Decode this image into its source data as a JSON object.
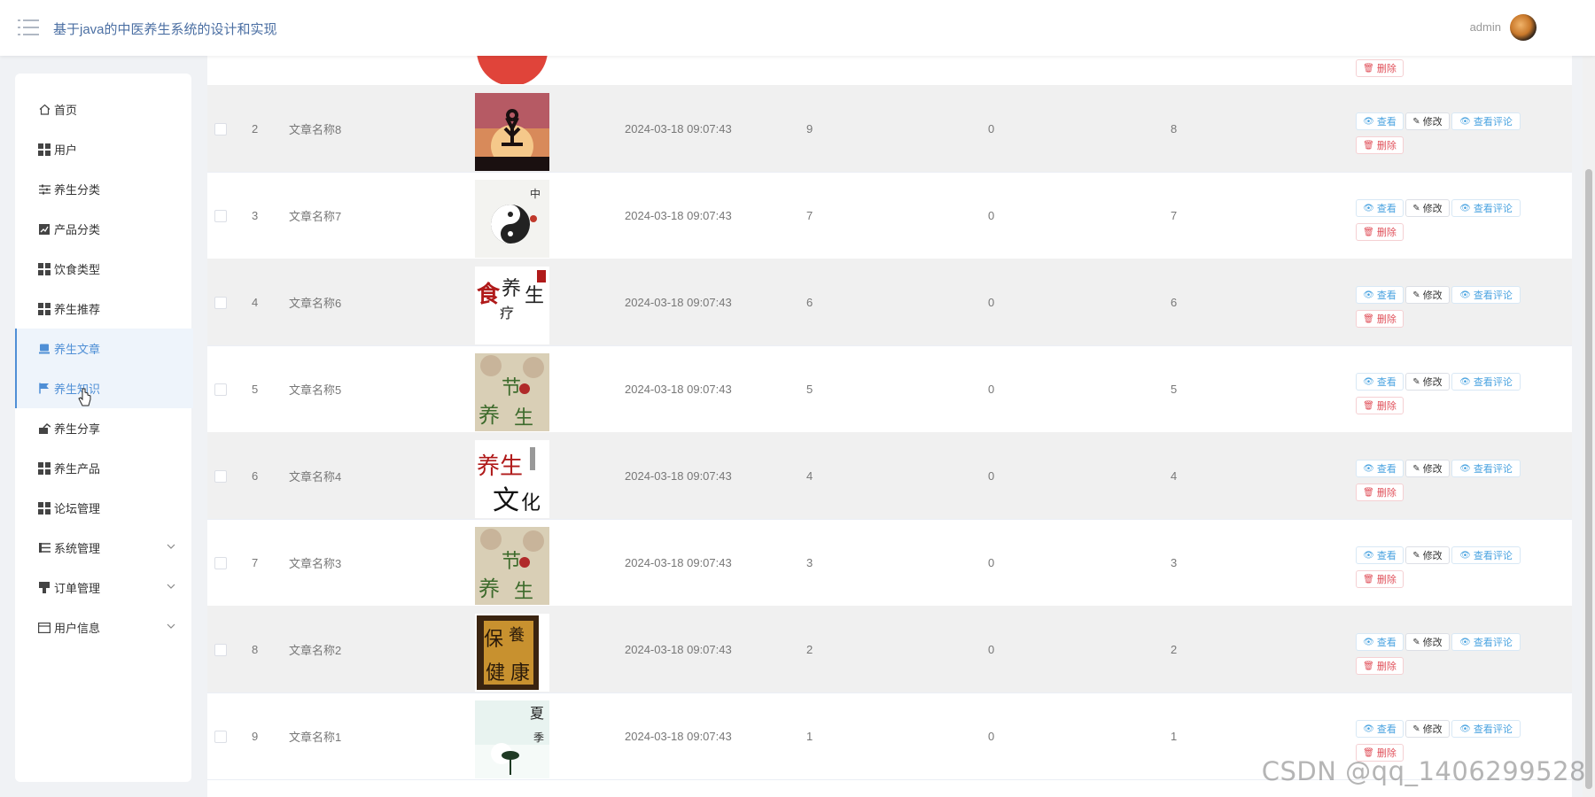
{
  "header": {
    "title": "基于java的中医养生系统的设计和实现",
    "user": "admin"
  },
  "sidebar": {
    "items": [
      {
        "label": "首页",
        "icon": "home-icon"
      },
      {
        "label": "用户",
        "icon": "grid-icon"
      },
      {
        "label": "养生分类",
        "icon": "sliders-icon"
      },
      {
        "label": "产品分类",
        "icon": "chart-icon"
      },
      {
        "label": "饮食类型",
        "icon": "grid-icon"
      },
      {
        "label": "养生推荐",
        "icon": "grid-icon"
      },
      {
        "label": "养生文章",
        "icon": "article-icon",
        "active": true
      },
      {
        "label": "养生知识",
        "icon": "flag-icon",
        "active": true
      },
      {
        "label": "养生分享",
        "icon": "share-icon"
      },
      {
        "label": "养生产品",
        "icon": "grid-icon"
      },
      {
        "label": "论坛管理",
        "icon": "grid-icon"
      },
      {
        "label": "系统管理",
        "icon": "list-icon",
        "expandable": true
      },
      {
        "label": "订单管理",
        "icon": "stamp-icon",
        "expandable": true
      },
      {
        "label": "用户信息",
        "icon": "card-icon",
        "expandable": true
      }
    ]
  },
  "actions": {
    "view": "查看",
    "edit": "修改",
    "comments": "查看评论",
    "delete": "删除"
  },
  "rows": [
    {
      "index": "2",
      "name": "文章名称8",
      "time": "2024-03-18 09:07:43",
      "c1": "9",
      "c2": "0",
      "c3": "8",
      "thumb": "yoga"
    },
    {
      "index": "3",
      "name": "文章名称7",
      "time": "2024-03-18 09:07:43",
      "c1": "7",
      "c2": "0",
      "c3": "7",
      "thumb": "taiji"
    },
    {
      "index": "4",
      "name": "文章名称6",
      "time": "2024-03-18 09:07:43",
      "c1": "6",
      "c2": "0",
      "c3": "6",
      "thumb": "shiliao"
    },
    {
      "index": "5",
      "name": "文章名称5",
      "time": "2024-03-18 09:07:43",
      "c1": "5",
      "c2": "0",
      "c3": "5",
      "thumb": "jieqi"
    },
    {
      "index": "6",
      "name": "文章名称4",
      "time": "2024-03-18 09:07:43",
      "c1": "4",
      "c2": "0",
      "c3": "4",
      "thumb": "wenhua"
    },
    {
      "index": "7",
      "name": "文章名称3",
      "time": "2024-03-18 09:07:43",
      "c1": "3",
      "c2": "0",
      "c3": "3",
      "thumb": "jieqi"
    },
    {
      "index": "8",
      "name": "文章名称2",
      "time": "2024-03-18 09:07:43",
      "c1": "2",
      "c2": "0",
      "c3": "2",
      "thumb": "baojian"
    },
    {
      "index": "9",
      "name": "文章名称1",
      "time": "2024-03-18 09:07:43",
      "c1": "1",
      "c2": "0",
      "c3": "1",
      "thumb": "xia"
    }
  ],
  "watermark": "CSDN @qq_1406299528",
  "colors": {
    "accent": "#4f8fd6",
    "danger": "#e0505a",
    "stripe": "#f0f0f0"
  }
}
